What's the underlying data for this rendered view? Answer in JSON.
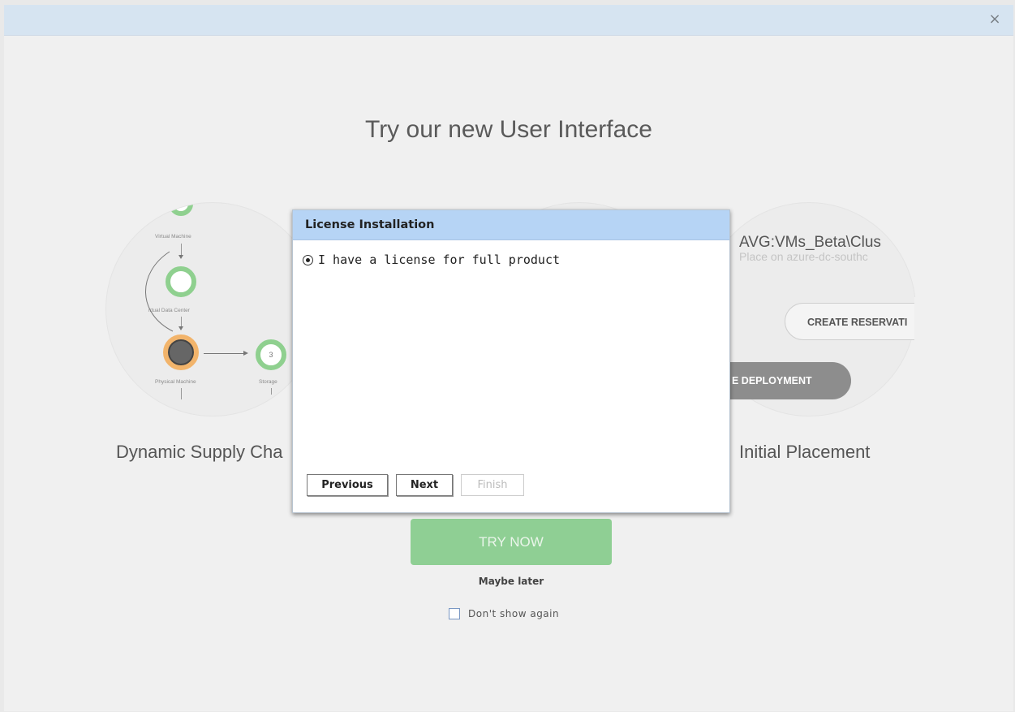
{
  "window": {
    "close_icon": "×"
  },
  "onboarding": {
    "title": "Try our new User Interface",
    "features": [
      {
        "caption": "Dynamic Supply Cha",
        "diagram": {
          "virtual_machine": "Virtual Machine",
          "virtual_data_center": "irtual Data Center",
          "physical_machine": "Physical Machine",
          "storage": "Storage",
          "storage_count": "3"
        }
      },
      {
        "caption": "Initial Placement",
        "vm_name": "AVG:VMs_Beta\\Clus",
        "placement": "Place on azure-dc-southc",
        "reserve_label": "CREATE RESERVATI",
        "deploy_label": "E DEPLOYMENT"
      }
    ],
    "try_now_label": "TRY NOW",
    "maybe_later_label": "Maybe later",
    "dont_show_label": "Don't show again",
    "dont_show_checked": false
  },
  "dialog": {
    "title": "License Installation",
    "option_label": "I have a license for full product",
    "option_selected": true,
    "buttons": {
      "previous": "Previous",
      "next": "Next",
      "finish": "Finish"
    },
    "finish_enabled": false
  },
  "colors": {
    "header_bar": "#d6e4f1",
    "dialog_header": "#b6d4f5",
    "try_now_bg": "#8fcf94",
    "ring_green": "#8fd08f",
    "ring_orange": "#f2b46b"
  }
}
